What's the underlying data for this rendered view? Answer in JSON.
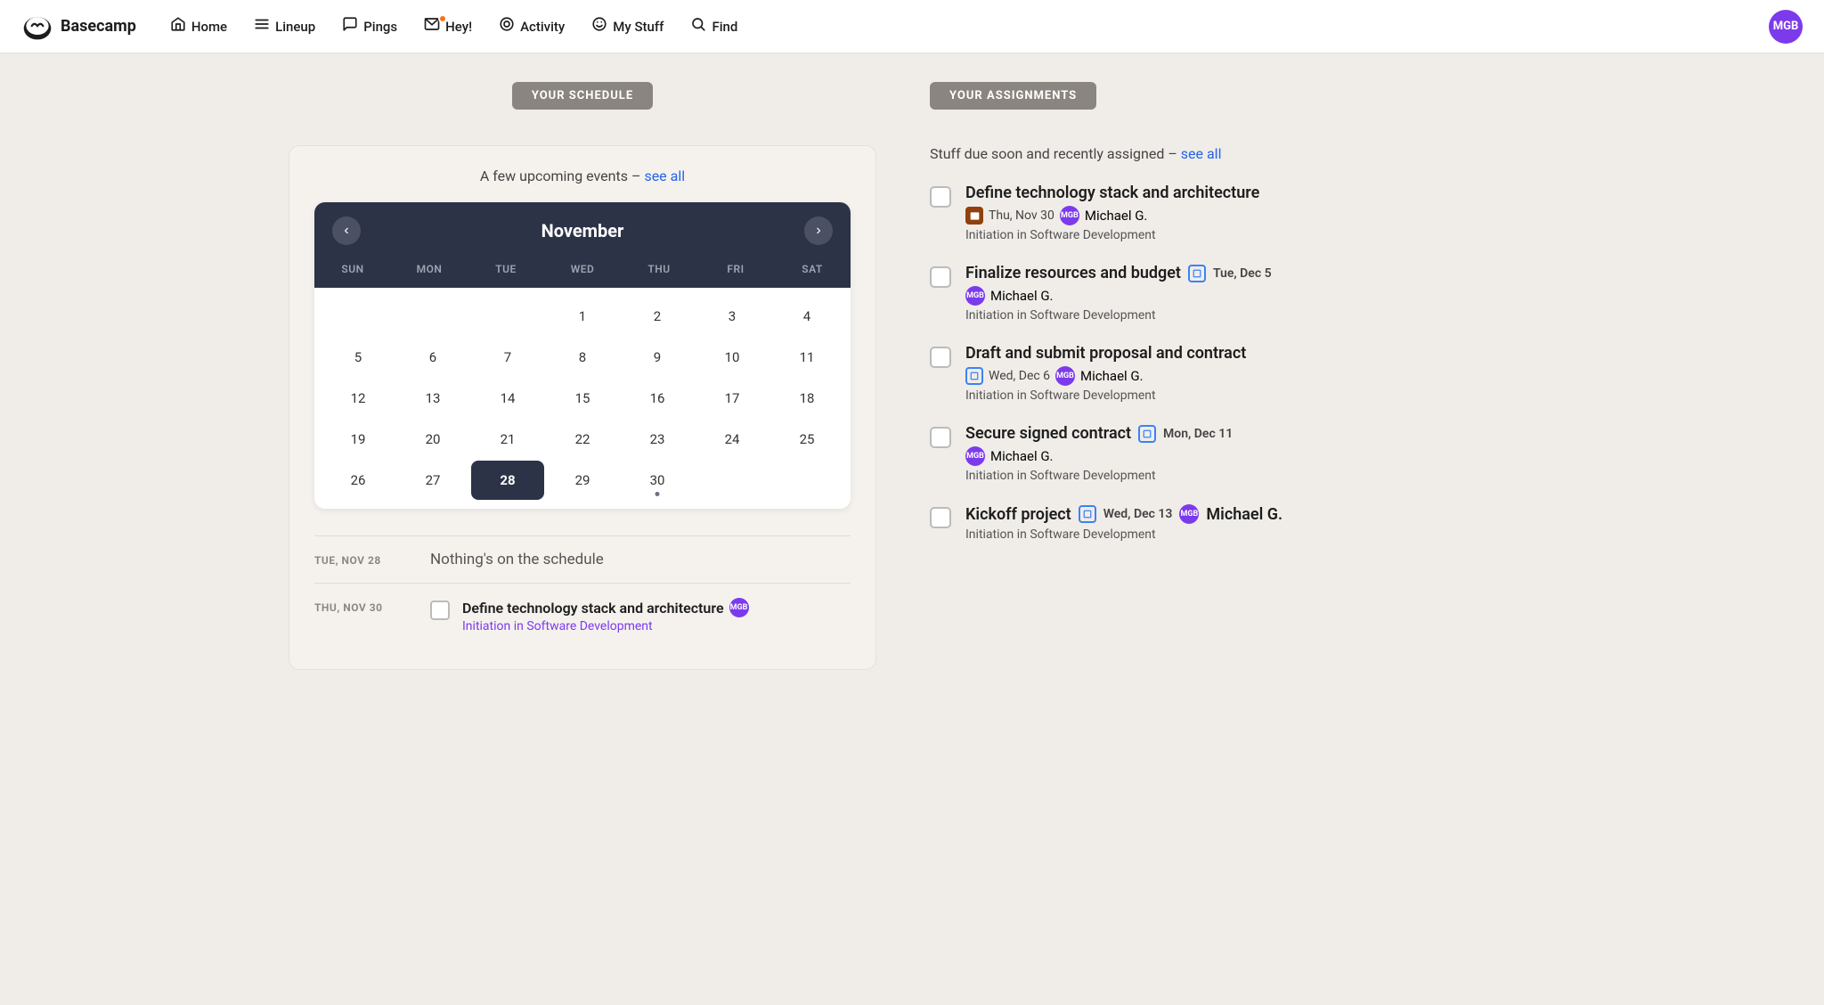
{
  "nav": {
    "logo_text": "Basecamp",
    "items": [
      {
        "id": "home",
        "label": "Home",
        "icon": "⌂",
        "has_dot": false
      },
      {
        "id": "lineup",
        "label": "Lineup",
        "icon": "≡",
        "has_dot": false
      },
      {
        "id": "pings",
        "label": "Pings",
        "icon": "💬",
        "has_dot": false
      },
      {
        "id": "hey",
        "label": "Hey!",
        "icon": "📥",
        "has_dot": true
      },
      {
        "id": "activity",
        "label": "Activity",
        "icon": "◎",
        "has_dot": false
      },
      {
        "id": "mystuff",
        "label": "My Stuff",
        "icon": "☺",
        "has_dot": false
      },
      {
        "id": "find",
        "label": "Find",
        "icon": "🔍",
        "has_dot": false
      }
    ],
    "avatar_initials": "MGB"
  },
  "schedule": {
    "header": "YOUR SCHEDULE",
    "subtitle_text": "A few upcoming events –",
    "subtitle_link": "see all",
    "calendar": {
      "month": "November",
      "day_names": [
        "SUN",
        "MON",
        "TUE",
        "WED",
        "THU",
        "FRI",
        "SAT"
      ],
      "weeks": [
        [
          "",
          "",
          "",
          "1",
          "2",
          "3",
          "4"
        ],
        [
          "5",
          "6",
          "7",
          "8",
          "9",
          "10",
          "11"
        ],
        [
          "12",
          "13",
          "14",
          "15",
          "16",
          "17",
          "18"
        ],
        [
          "19",
          "20",
          "21",
          "22",
          "23",
          "24",
          "25"
        ],
        [
          "26",
          "27",
          "28",
          "29",
          "30",
          "",
          ""
        ]
      ],
      "today": "28",
      "event_dots": [
        "30"
      ]
    },
    "events": [
      {
        "date_label": "TUE, NOV 28",
        "type": "empty",
        "empty_text": "Nothing's on the schedule"
      },
      {
        "date_label": "THU, NOV 30",
        "type": "task",
        "title": "Define technology stack and architecture",
        "avatar": "MGB",
        "project": "Initiation in Software Development"
      }
    ]
  },
  "assignments": {
    "header": "YOUR ASSIGNMENTS",
    "subtitle_text": "Stuff due soon and recently assigned –",
    "subtitle_link": "see all",
    "items": [
      {
        "title": "Define technology stack and architecture",
        "due_icon": "brown",
        "due_text": "Thu, Nov 30",
        "avatar": "MGB",
        "person": "Michael G.",
        "project": "Initiation in Software Development"
      },
      {
        "title": "Finalize resources and budget",
        "due_icon": "blue",
        "due_text": "Tue, Dec 5",
        "avatar": "MGB",
        "person": "Michael G.",
        "project": "Initiation in Software Development"
      },
      {
        "title": "Draft and submit proposal and contract",
        "due_icon": "blue",
        "due_text": "Wed, Dec 6",
        "avatar": "MGB",
        "person": "Michael G.",
        "project": "Initiation in Software Development"
      },
      {
        "title": "Secure signed contract",
        "due_icon": "blue",
        "due_text": "Mon, Dec 11",
        "avatar": "MGB",
        "person": "Michael G.",
        "project": "Initiation in Software Development"
      },
      {
        "title": "Kickoff project",
        "due_icon": "blue",
        "due_text": "Wed, Dec 13",
        "avatar": "MGB",
        "person": "Michael G.",
        "project": "Initiation in Software Development"
      }
    ]
  }
}
